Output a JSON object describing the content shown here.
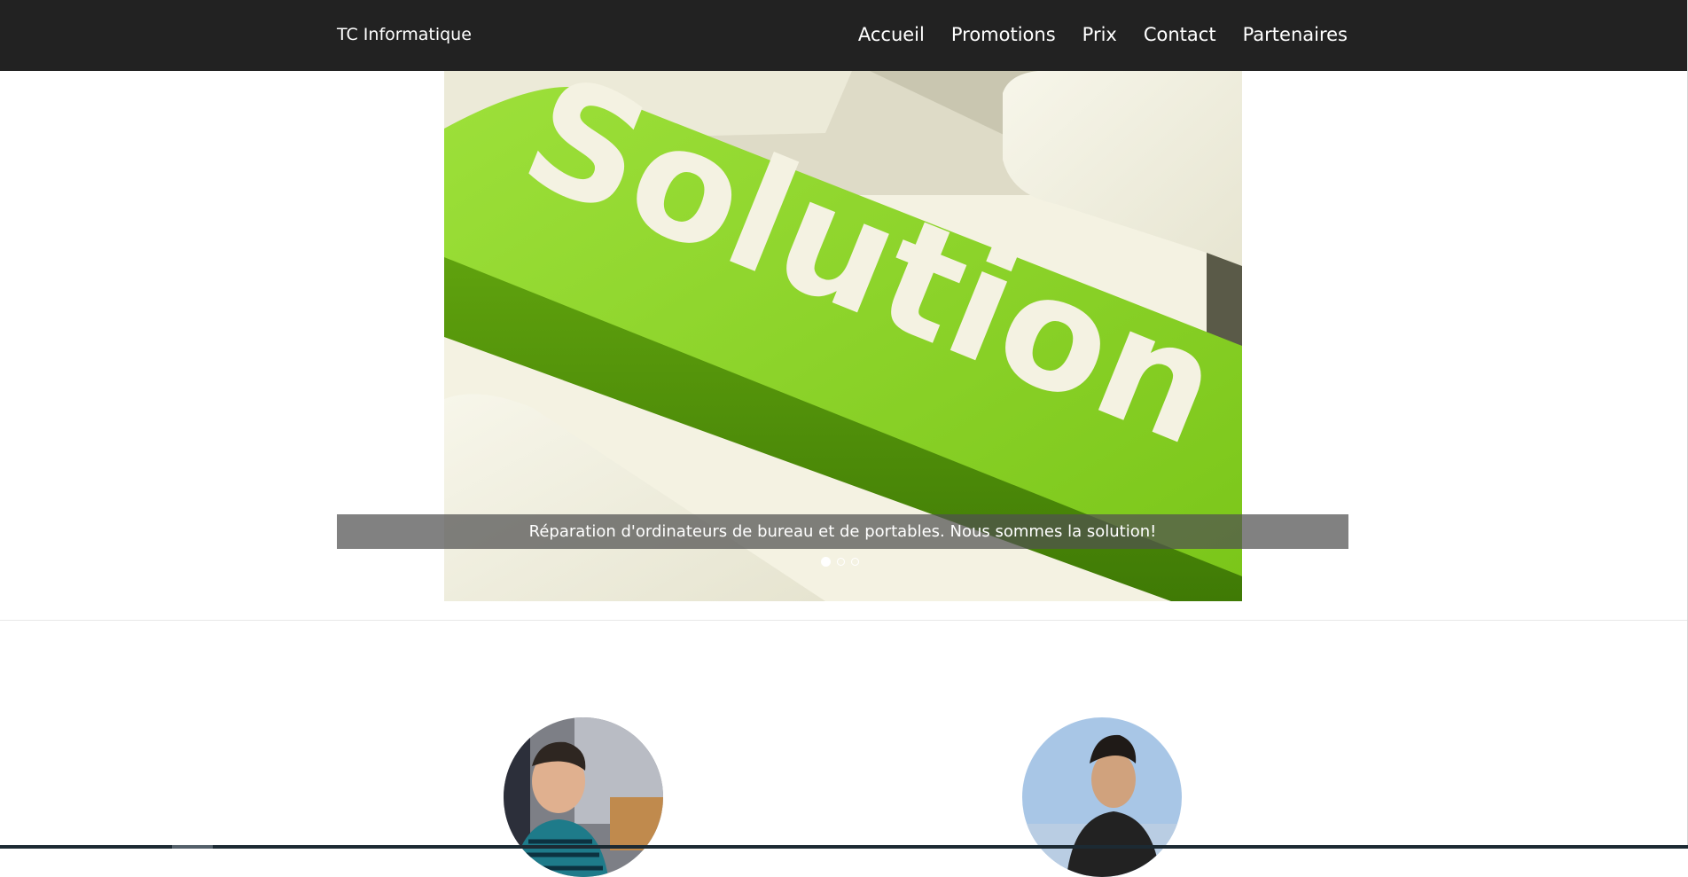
{
  "navbar": {
    "brand": "TC Informatique",
    "items": [
      {
        "label": "Accueil"
      },
      {
        "label": "Promotions"
      },
      {
        "label": "Prix"
      },
      {
        "label": "Contact"
      },
      {
        "label": "Partenaires"
      }
    ]
  },
  "carousel": {
    "image_text": "Solution",
    "caption": "Réparation d'ordinateurs de bureau et de portables. Nous sommes la solution!",
    "active_index": 0,
    "slide_count": 3
  },
  "team": {
    "avatars": [
      {
        "name": "avatar-left"
      },
      {
        "name": "avatar-right"
      }
    ]
  },
  "colors": {
    "navbar_bg": "#222222",
    "key_green": "#8fdd2a",
    "key_cream": "#f4f2e2"
  }
}
